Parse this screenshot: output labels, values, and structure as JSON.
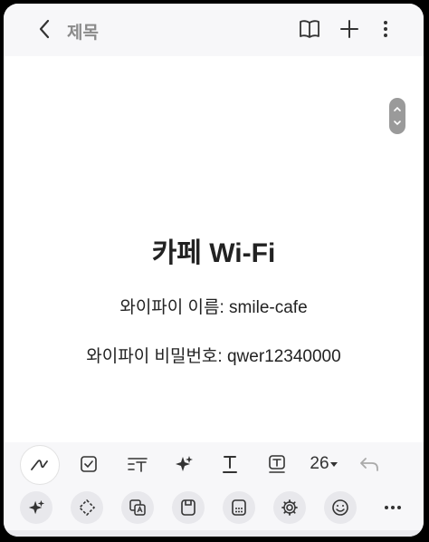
{
  "header": {
    "title": "제목",
    "back_icon": "chevron-left-icon",
    "actions": [
      "book-open-icon",
      "plus-icon",
      "more-vertical-icon"
    ]
  },
  "note": {
    "title": "카페 Wi-Fi",
    "lines": [
      "와이파이 이름: smile-cafe",
      "와이파이 비밀번호: qwer12340000"
    ]
  },
  "toolbar": {
    "font_size": "26",
    "tools": [
      "pen-icon",
      "checkbox-icon",
      "text-style-icon",
      "sparkle-icon",
      "text-underline-icon",
      "text-box-icon",
      "undo-icon"
    ]
  },
  "bottom_tools": [
    "ai-sparkle-icon",
    "select-icon",
    "translate-icon",
    "save-icon",
    "calculator-icon",
    "settings-icon",
    "emoji-icon",
    "more-horizontal-icon"
  ],
  "colors": {
    "background": "#ffffff",
    "toolbar": "#f7f7f9",
    "text": "#222222"
  }
}
